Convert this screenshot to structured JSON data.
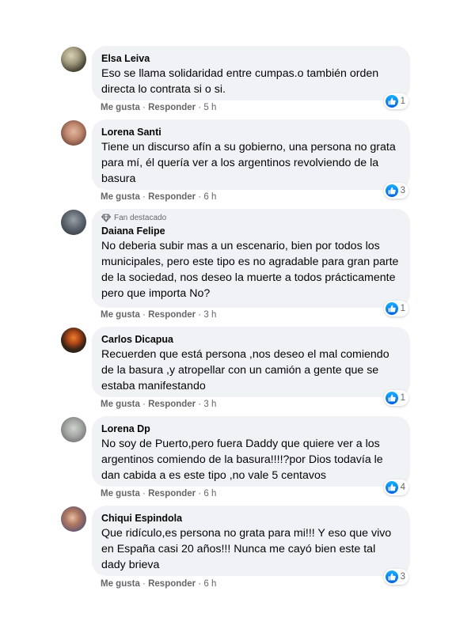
{
  "badge_text": "Fan destacado",
  "action_like": "Me gusta",
  "action_reply": "Responder",
  "separator": "·",
  "comments": [
    {
      "author": "Elsa Leiva",
      "text": "Eso se llama solidaridad entre cumpas.o también orden directa lo contrata si o si.",
      "reactions": "1",
      "time": "5 h"
    },
    {
      "author": "Lorena Santi",
      "text": "Tiene un discurso afín a su gobierno, una persona no grata para mí, él quería ver a los argentinos revolviendo de la basura",
      "reactions": "3",
      "time": "6 h"
    },
    {
      "author": "Daiana Felipe",
      "text": "No deberia subir mas a un escenario, bien por todos los municipales, pero este tipo es no agradable para gran parte de la sociedad, nos deseo la muerte a todos prácticamente pero que importa No?",
      "reactions": "1",
      "time": "3 h"
    },
    {
      "author": "Carlos Dicapua",
      "text": "Recuerden que está persona ,nos deseo el mal comiendo de la basura ,y atropellar con un camión a gente que se estaba manifestando",
      "reactions": "1",
      "time": "3 h"
    },
    {
      "author": "Lorena Dp",
      "text": "No soy de Puerto,pero fuera Daddy que quiere ver a los argentinos comiendo de la basura!!!!?por Dios todavía le dan cabida a es este tipo ,no vale 5 centavos",
      "reactions": "4",
      "time": "6 h"
    },
    {
      "author": "Chiqui Espindola",
      "text": "Que ridículo,es persona no grata para mi!!! Y eso que vivo en España casi 20 años!!! Nunca me cayó bien este tal dady brieva",
      "reactions": "3",
      "time": "6 h"
    }
  ],
  "colors": {
    "bubble": "#f0f2f5",
    "secondary_text": "#65676b",
    "like_blue": "#1877f2"
  },
  "icons": {
    "badge": "diamond-icon",
    "reaction": "like-icon"
  }
}
